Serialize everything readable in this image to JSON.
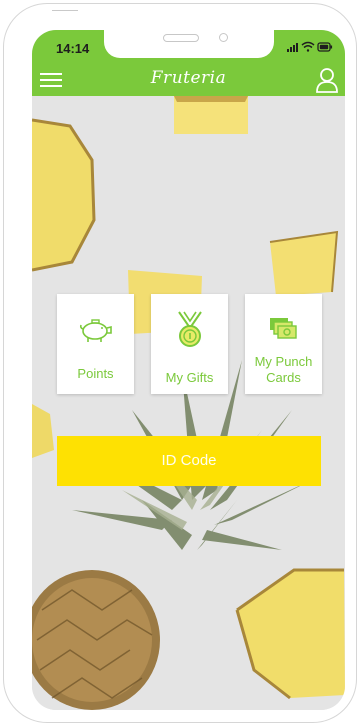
{
  "status_bar": {
    "time": "14:14"
  },
  "header": {
    "logo_text": "Fruteria"
  },
  "tiles": [
    {
      "label": "Points",
      "icon": "piggy-bank-icon"
    },
    {
      "label": "My Gifts",
      "icon": "medal-icon"
    },
    {
      "label": "My Punch Cards",
      "icon": "punch-cards-icon"
    }
  ],
  "id_button": {
    "label": "ID Code"
  },
  "colors": {
    "brand_green": "#7bc93b",
    "accent_yellow": "#fee102"
  }
}
